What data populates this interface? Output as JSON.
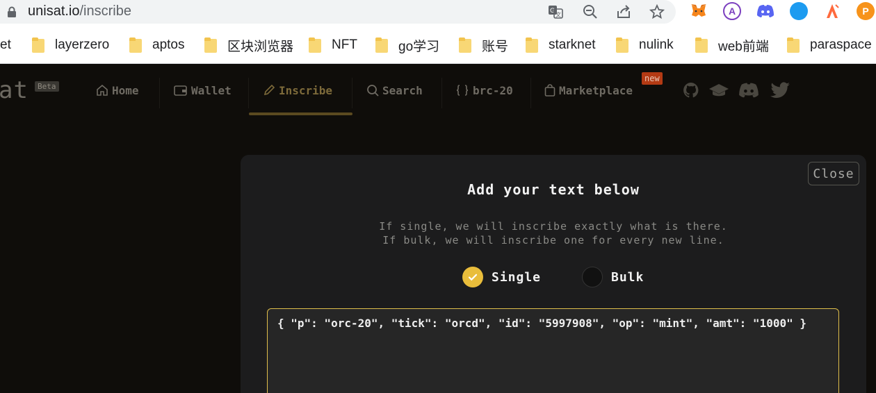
{
  "browser": {
    "url_domain": "unisat.io",
    "url_path": "/inscribe",
    "bookmarks": [
      {
        "label": "et"
      },
      {
        "label": "layerzero"
      },
      {
        "label": "aptos"
      },
      {
        "label": "区块浏览器"
      },
      {
        "label": "NFT"
      },
      {
        "label": "go学习"
      },
      {
        "label": "账号"
      },
      {
        "label": "starknet"
      },
      {
        "label": "nulink"
      },
      {
        "label": "web前端"
      },
      {
        "label": "paraspace"
      }
    ],
    "extensions": [
      "metamask-icon",
      "arbitrum-icon",
      "discord-icon",
      "blue-dot-icon",
      "arweave-icon",
      "paraspace-icon"
    ]
  },
  "site": {
    "logo_text": "at",
    "beta_badge": "Beta",
    "nav": {
      "home": "Home",
      "wallet": "Wallet",
      "inscribe": "Inscribe",
      "search": "Search",
      "brc20": "brc-20",
      "marketplace": "Marketplace",
      "new_badge": "new"
    },
    "active_nav": "inscribe"
  },
  "modal": {
    "close_label": "Close",
    "title": "Add your text below",
    "desc_line1": "If single, we will inscribe exactly what is there.",
    "desc_line2": "If bulk, we will inscribe one for every new line.",
    "option_single": "Single",
    "option_bulk": "Bulk",
    "selected": "Single",
    "text_value": "{ \"p\": \"orc-20\", \"tick\": \"orcd\", \"id\": \"5997908\", \"op\": \"mint\", \"amt\": \"1000\" }",
    "accent_color": "#e9bd3b"
  }
}
